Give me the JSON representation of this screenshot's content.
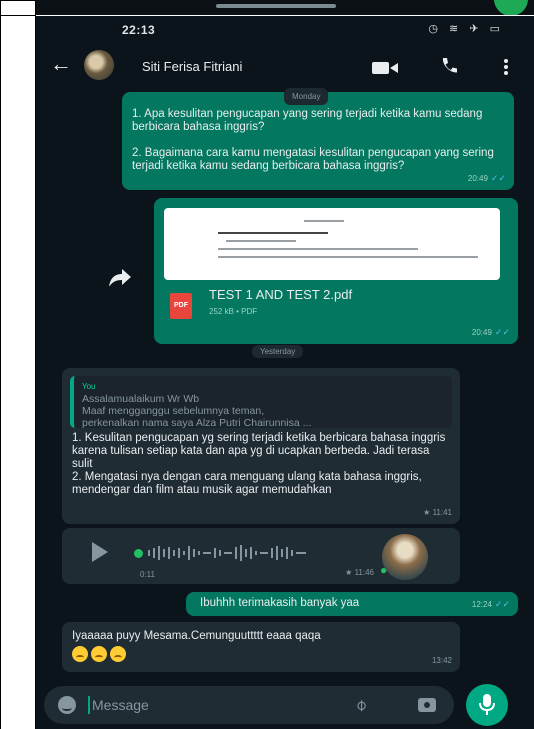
{
  "status_bar": {
    "time": "22:13",
    "icons": "◷ ≋ ✈ ▭"
  },
  "header": {
    "contact_name": "Siti Ferisa Fitriani"
  },
  "chat": {
    "date_labels": [
      "Monday",
      "Yesterday"
    ],
    "messages": [
      {
        "text": "1. Apa kesulitan pengucapan yang sering terjadi ketika kamu sedang berbicara bahasa inggris?\n\n2. Bagaimana cara kamu mengatasi kesulitan pengucapan yang sering terjadi ketika kamu sedang berbicara bahasa inggris?",
        "time": "20:49"
      },
      {
        "doc_name": "TEST 1 AND TEST 2.pdf",
        "doc_meta": "252 kB • PDF",
        "pdf_label": "PDF",
        "time": "20:49"
      },
      {
        "quote_author": "You",
        "quote_text": "Assalamualaikum Wr Wb\nMaaf mengganggu sebelumnya teman,\nperkenalkan nama saya Alza Putri Chairunnisa ...",
        "text": "1. Kesulitan pengucapan yg sering terjadi ketika berbicara bahasa inggris karena tulisan setiap kata dan apa yg di ucapkan berbeda. Jadi terasa sulit\n2. Mengatasi nya dengan cara menguang ulang kata bahasa inggris, mendengar dan film atau musik agar memudahkan",
        "time": "11:41"
      },
      {
        "voice_duration": "0:11",
        "time": "11:46"
      },
      {
        "text": "Ibuhhh terimakasih banyak yaa",
        "time": "12:24"
      },
      {
        "text": "Iyaaaaa puyy Mesama.Cemunguuttttt eaaa qaqa",
        "time": "13:42"
      }
    ]
  },
  "input": {
    "placeholder": "Message"
  },
  "colors": {
    "outgoing": "#03775f",
    "incoming": "#202c33",
    "background": "#0b141a",
    "accent": "#00a884",
    "read_ticks": "#53bdeb"
  }
}
